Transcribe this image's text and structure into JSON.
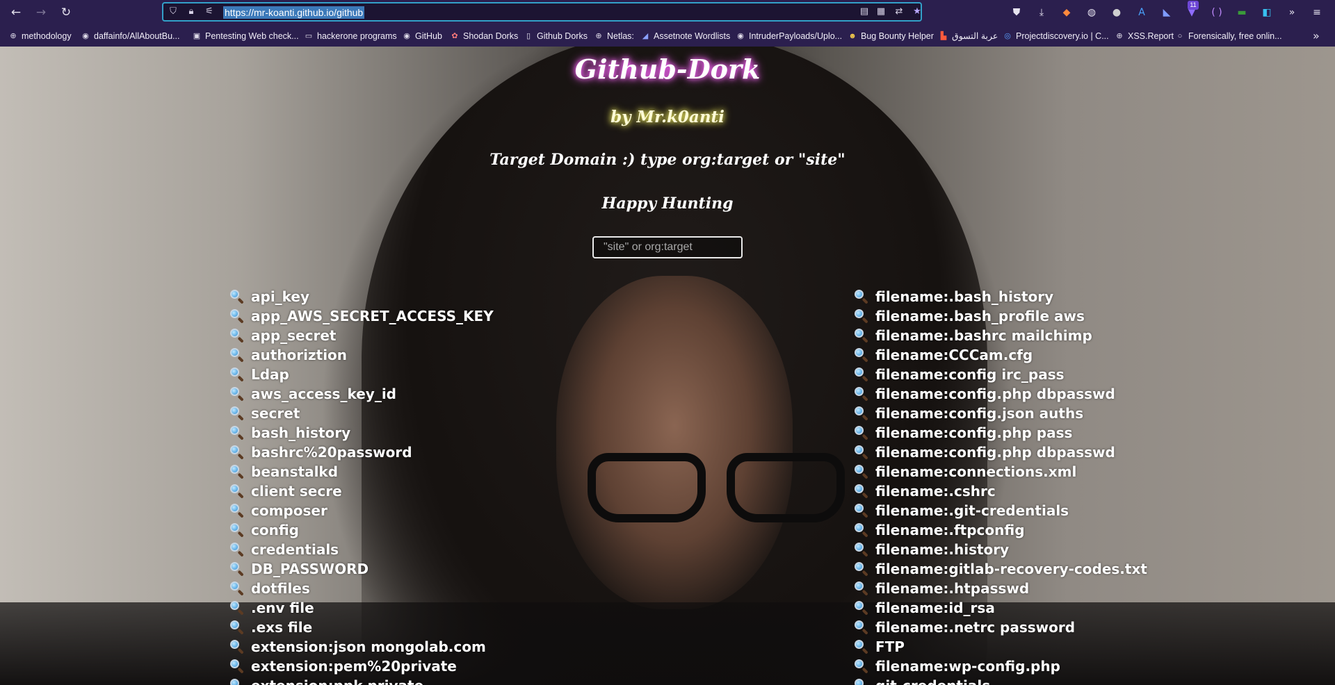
{
  "browser": {
    "url": "https://mr-koanti.github.io/github",
    "extension_badge": "11",
    "bookmarks": [
      {
        "label": "methodology",
        "icon": "globe-icon"
      },
      {
        "label": "daffainfo/AllAboutBu...",
        "icon": "github-icon"
      },
      {
        "label": "Pentesting Web check...",
        "icon": "page-icon"
      },
      {
        "label": "hackerone programs",
        "icon": "folder-icon"
      },
      {
        "label": "GitHub",
        "icon": "github-icon"
      },
      {
        "label": "Shodan Dorks",
        "icon": "shodan-icon"
      },
      {
        "label": "Github Dorks",
        "icon": "page-icon"
      },
      {
        "label": "Netlas:",
        "icon": "globe-icon"
      },
      {
        "label": "Assetnote Wordlists",
        "icon": "assetnote-icon"
      },
      {
        "label": "IntruderPayloads/Uplo...",
        "icon": "github-icon"
      },
      {
        "label": "Bug Bounty Helper",
        "icon": "emoji-icon"
      },
      {
        "label": "عربة التسوق",
        "icon": "cart-icon"
      },
      {
        "label": "Projectdiscovery.io | C...",
        "icon": "projectdiscovery-icon"
      },
      {
        "label": "XSS.Report",
        "icon": "globe-icon"
      },
      {
        "label": "Forensically, free onlin...",
        "icon": "search-icon"
      }
    ]
  },
  "page": {
    "title": "Github-Dork",
    "byline": "by Mr.k0anti",
    "target_text": "Target Domain :) type org:target or \"site\"",
    "happy_text": "Happy Hunting",
    "search_placeholder": "\"site\" or org:target",
    "search_value": ""
  },
  "dorks_left": [
    "api_key",
    "app_AWS_SECRET_ACCESS_KEY",
    "app_secret",
    "authoriztion",
    "Ldap",
    "aws_access_key_id",
    "secret",
    "bash_history",
    "bashrc%20password",
    "beanstalkd",
    "client secre",
    "composer",
    "config",
    "credentials",
    "DB_PASSWORD",
    "dotfiles",
    ".env file",
    ".exs file",
    "extension:json mongolab.com",
    "extension:pem%20private",
    "extension:ppk private"
  ],
  "dorks_right": [
    "filename:.bash_history",
    "filename:.bash_profile aws",
    "filename:.bashrc mailchimp",
    "filename:CCCam.cfg",
    "filename:config irc_pass",
    "filename:config.php dbpasswd",
    "filename:config.json auths",
    "filename:config.php pass",
    "filename:config.php dbpasswd",
    "filename:connections.xml",
    "filename:.cshrc",
    "filename:.git-credentials",
    "filename:.ftpconfig",
    "filename:.history",
    "filename:gitlab-recovery-codes.txt",
    "filename:.htpasswd",
    "filename:id_rsa",
    "filename:.netrc password",
    "FTP",
    "filename:wp-config.php",
    "git-credentials"
  ],
  "colors": {
    "chrome_bg": "#2b1f4e",
    "urlbar_focus": "#33a0c9",
    "title_glow": "#ff66ff",
    "byline_glow": "#e9e65b"
  }
}
